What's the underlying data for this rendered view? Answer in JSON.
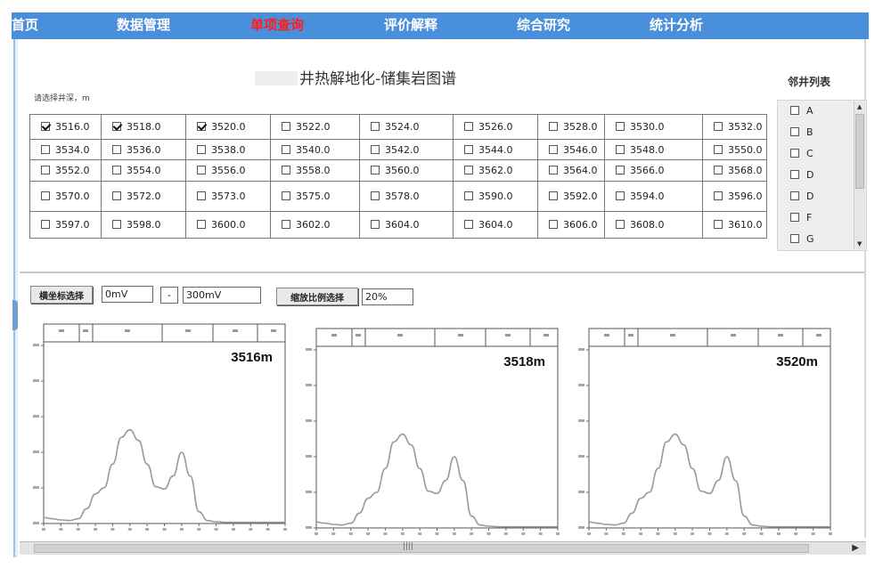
{
  "nav": {
    "items": [
      {
        "label": "首页",
        "active": false
      },
      {
        "label": "数据管理",
        "active": false
      },
      {
        "label": "单项查询",
        "active": true
      },
      {
        "label": "评价解释",
        "active": false
      },
      {
        "label": "综合研究",
        "active": false
      },
      {
        "label": "统计分析",
        "active": false
      }
    ]
  },
  "page": {
    "title": "井热解地化-储集岩图谱",
    "depth_prompt": "请选择井深，m"
  },
  "depths": [
    [
      "3516.0",
      "3518.0",
      "3520.0",
      "3522.0",
      "3524.0",
      "3526.0",
      "3528.0",
      "3530.0",
      "3532.0"
    ],
    [
      "3534.0",
      "3536.0",
      "3538.0",
      "3540.0",
      "3542.0",
      "3544.0",
      "3546.0",
      "3548.0",
      "3550.0"
    ],
    [
      "3552.0",
      "3554.0",
      "3556.0",
      "3558.0",
      "3560.0",
      "3562.0",
      "3564.0",
      "3566.0",
      "3568.0"
    ],
    [
      "3570.0",
      "3572.0",
      "3573.0",
      "3575.0",
      "3578.0",
      "3590.0",
      "3592.0",
      "3594.0",
      "3596.0"
    ],
    [
      "3597.0",
      "3598.0",
      "3600.0",
      "3602.0",
      "3604.0",
      "3604.0",
      "3606.0",
      "3608.0",
      "3610.0"
    ]
  ],
  "checked_depths": [
    "3516.0",
    "3518.0",
    "3520.0"
  ],
  "neighbor_wells": {
    "title": "邻井列表",
    "items": [
      "A",
      "B",
      "C",
      "D",
      "D",
      "F",
      "G"
    ]
  },
  "controls": {
    "x_axis_button": "横坐标选择",
    "x_from": "0mV",
    "range_sep": "-",
    "x_to": "300mV",
    "scale_button": "缩放比例选择",
    "scale_value": "20%"
  },
  "colors": {
    "nav_bg": "#4a8fdc",
    "nav_active": "#ff1e1e",
    "curve": "#9a9a9a"
  },
  "charts": [
    {
      "depth_label": "3516m"
    },
    {
      "depth_label": "3518m"
    },
    {
      "depth_label": "3520m"
    }
  ],
  "chart_data": [
    {
      "type": "line",
      "title": "3516m",
      "xlim": [
        0,
        14
      ],
      "ylim": [
        0,
        300
      ],
      "grid": false,
      "series": [
        {
          "x": [
            0,
            0.5,
            1,
            1.5,
            2,
            2.5,
            3,
            3.5,
            4,
            4.5,
            5,
            5.5,
            6,
            6.5,
            7,
            7.5,
            8,
            8.5,
            9,
            9.5,
            10,
            10.5,
            11,
            11.5,
            12,
            13,
            14
          ],
          "values": [
            10,
            8,
            6,
            5,
            8,
            25,
            50,
            60,
            100,
            145,
            158,
            140,
            100,
            62,
            58,
            80,
            120,
            80,
            20,
            5,
            3,
            2,
            2,
            2,
            2,
            2,
            2
          ]
        }
      ]
    },
    {
      "type": "line",
      "title": "3518m",
      "xlim": [
        0,
        14
      ],
      "ylim": [
        0,
        300
      ],
      "grid": false,
      "series": [
        {
          "x": [
            0,
            0.5,
            1,
            1.5,
            2,
            2.5,
            3,
            3.5,
            4,
            4.5,
            5,
            5.5,
            6,
            6.5,
            7,
            7.5,
            8,
            8.5,
            9,
            9.5,
            10,
            10.5,
            11,
            11.5,
            12,
            13,
            14
          ],
          "values": [
            10,
            8,
            6,
            5,
            8,
            25,
            50,
            60,
            100,
            145,
            158,
            140,
            100,
            62,
            58,
            80,
            120,
            80,
            20,
            5,
            3,
            2,
            2,
            2,
            2,
            2,
            2
          ]
        }
      ]
    },
    {
      "type": "line",
      "title": "3520m",
      "xlim": [
        0,
        14
      ],
      "ylim": [
        0,
        300
      ],
      "grid": false,
      "series": [
        {
          "x": [
            0,
            0.5,
            1,
            1.5,
            2,
            2.5,
            3,
            3.5,
            4,
            4.5,
            5,
            5.5,
            6,
            6.5,
            7,
            7.5,
            8,
            8.5,
            9,
            9.5,
            10,
            10.5,
            11,
            11.5,
            12,
            13,
            14
          ],
          "values": [
            10,
            8,
            6,
            5,
            8,
            25,
            50,
            60,
            100,
            145,
            158,
            140,
            100,
            62,
            58,
            80,
            120,
            80,
            20,
            5,
            3,
            2,
            2,
            2,
            2,
            2,
            2
          ]
        }
      ]
    }
  ]
}
